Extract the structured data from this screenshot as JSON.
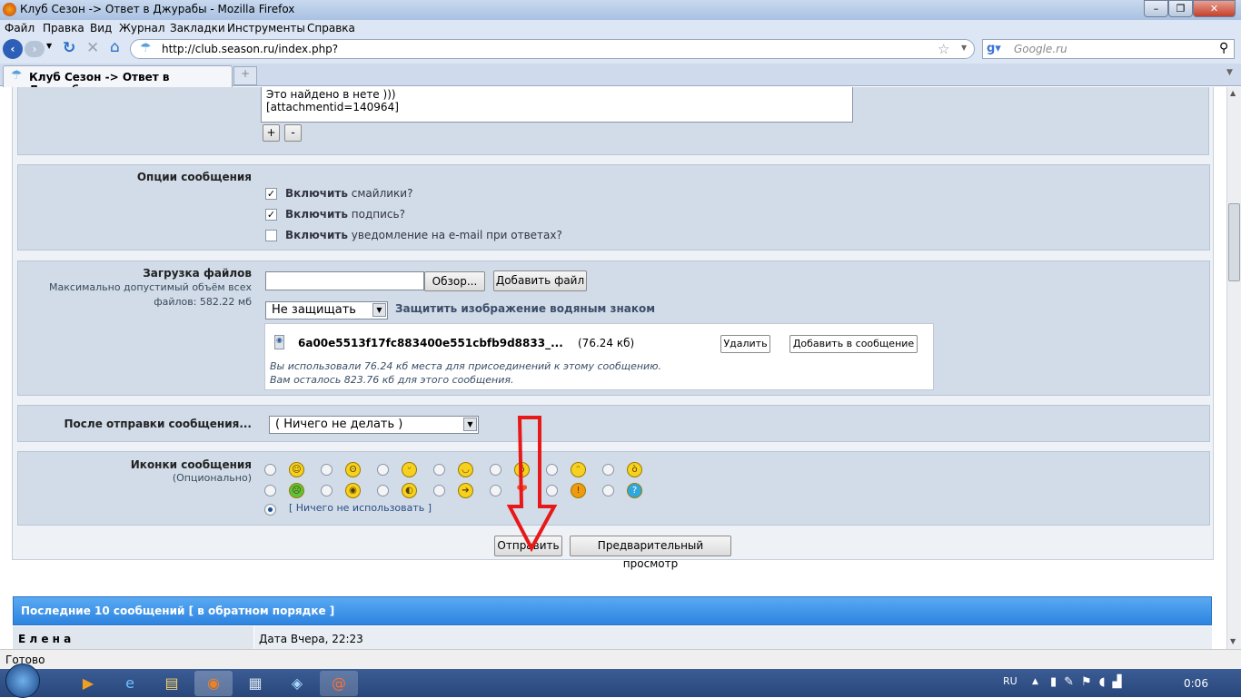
{
  "window": {
    "title": "Клуб Сезон -> Ответ в Джурабы - Mozilla Firefox"
  },
  "menu": [
    "Файл",
    "Правка",
    "Вид",
    "Журнал",
    "Закладки",
    "Инструменты",
    "Справка"
  ],
  "nav": {
    "url": "http://club.season.ru/index.php?",
    "search_placeholder": "Google.ru"
  },
  "tab": {
    "label": "Клуб Сезон -> Ответ в Джурабы",
    "new_tab": "+"
  },
  "editor": {
    "line1": "Это найдено в нете )))",
    "line2": "[attachmentid=140964]",
    "grow": "+",
    "shrink": "-"
  },
  "options": {
    "title": "Опции сообщения",
    "bold": "Включить",
    "items": [
      {
        "text": "смайлики?",
        "checked": true
      },
      {
        "text": "подпись?",
        "checked": true
      },
      {
        "text": "уведомление на e-mail при ответах?",
        "checked": false
      }
    ]
  },
  "upload": {
    "title": "Загрузка файлов",
    "note1": "Максимально допустимый объём всех",
    "note2": "файлов: 582.22 мб",
    "browse": "Обзор...",
    "add_file": "Добавить файл",
    "protect_select": "Не защищать",
    "protect_label": "Защитить изображение водяным знаком",
    "file_name": "6a00e5513f17fc883400e551cbfb9d8833_...",
    "file_size": "(76.24 кб)",
    "delete": "Удалить",
    "insert": "Добавить в сообщение",
    "used": "Вы использовали 76.24 кб места для присоединений к этому сообщению.",
    "left": "Вам осталось 823.76 кб для этого сообщения."
  },
  "after": {
    "label": "После отправки сообщения...",
    "value": "( Ничего не делать )"
  },
  "icons": {
    "title": "Иконки сообщения",
    "subtitle": "(Опционально)",
    "none": "[ Ничего не использовать ]",
    "row1": [
      "☺",
      "ʘ",
      "ᵕ",
      "◡",
      "ö",
      "ᵔ",
      "ò"
    ],
    "row2": [
      "☹",
      "◉",
      "◐",
      "➔",
      "❤",
      "!",
      "?"
    ]
  },
  "actions": {
    "submit": "Отправить",
    "preview": "Предварительный просмотр"
  },
  "recent": {
    "title": "Последние 10 сообщений [ в обратном порядке ]",
    "author": "Е л е н а",
    "date": "Дата Вчера, 22:23"
  },
  "status": "Готово",
  "tray": {
    "lang": "RU",
    "time": "0:06"
  }
}
